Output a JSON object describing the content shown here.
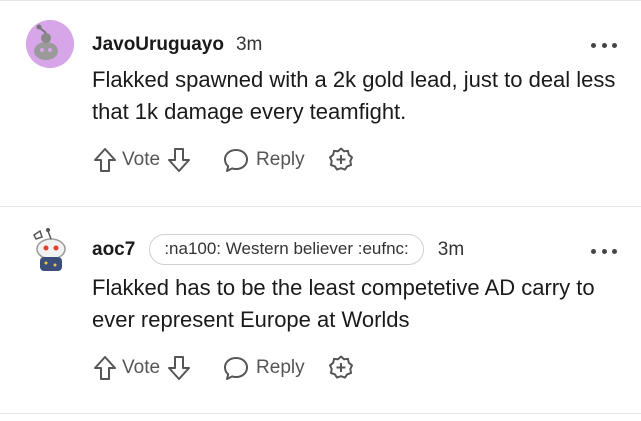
{
  "comments": [
    {
      "username": "JavoUruguayo",
      "timestamp": "3m",
      "flair": "",
      "text": "Flakked spawned with a 2k gold lead, just to deal less that 1k damage every teamfight.",
      "avatar_color": "#d7a6e8"
    },
    {
      "username": "aoc7",
      "timestamp": "3m",
      "flair": ":na100: Western believer :eufnc:",
      "text": "Flakked has to be the least competetive AD carry to ever represent Europe at Worlds",
      "avatar_color": "#ffffff"
    }
  ],
  "actions": {
    "vote_label": "Vote",
    "reply_label": "Reply"
  },
  "icons": {
    "upvote": "arrow-up-icon",
    "downvote": "arrow-down-icon",
    "reply": "speech-bubble-icon",
    "award": "plus-circle-icon",
    "more": "more-dots-icon"
  }
}
